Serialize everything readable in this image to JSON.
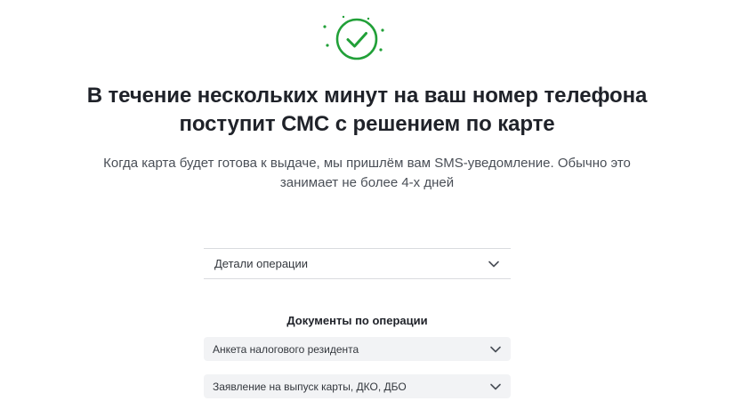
{
  "status": {
    "icon": "checkmark-circle-icon",
    "accent_color": "#21a038"
  },
  "headline": {
    "line1": "В течение нескольких минут на ваш номер телефона",
    "line2": "поступит СМС с решением по карте"
  },
  "subtext": {
    "line1": "Когда карта будет готова к выдаче, мы пришлём вам SMS-уведомление. Обычно это",
    "line2": "занимает не более 4-х дней"
  },
  "details": {
    "label": "Детали операции",
    "icon": "chevron-down-icon"
  },
  "documents": {
    "title": "Документы по операции",
    "items": [
      {
        "label": "Анкета налогового резидента",
        "icon": "chevron-down-icon"
      },
      {
        "label": "Заявление на выпуск карты, ДКО, ДБО",
        "icon": "chevron-down-icon"
      }
    ]
  }
}
